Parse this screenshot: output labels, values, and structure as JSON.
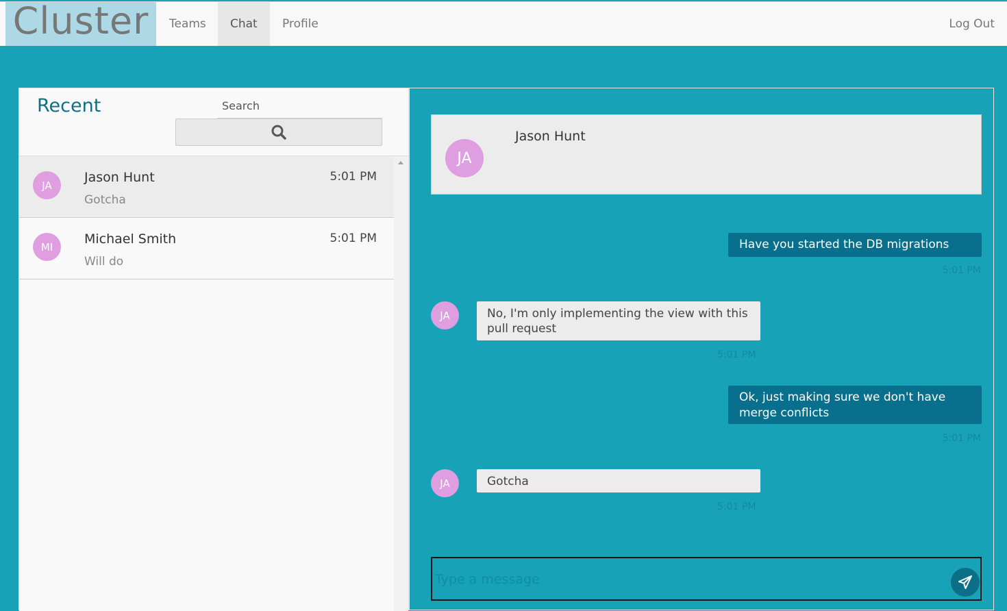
{
  "nav": {
    "brand": "Cluster",
    "items": [
      {
        "label": "Teams"
      },
      {
        "label": "Chat"
      },
      {
        "label": "Profile"
      }
    ],
    "logout": "Log Out"
  },
  "sidebar": {
    "title": "Recent",
    "search_label": "Search",
    "search_icon": "search-icon",
    "conversations": [
      {
        "initials": "JA",
        "name": "Jason Hunt",
        "time": "5:01 PM",
        "preview": "Gotcha"
      },
      {
        "initials": "MI",
        "name": "Michael Smith",
        "time": "5:01 PM",
        "preview": "Will do"
      }
    ]
  },
  "chat": {
    "contact": {
      "initials": "JA",
      "name": "Jason Hunt"
    },
    "messages": [
      {
        "direction": "out",
        "text": "Have you started the DB migrations",
        "time": "5:01 PM"
      },
      {
        "direction": "in",
        "initials": "JA",
        "text": "No, I'm only implementing the view with this pull request",
        "time": "5:01 PM"
      },
      {
        "direction": "out",
        "text": "Ok, just making sure we don't have merge conflicts",
        "time": "5:01 PM"
      },
      {
        "direction": "in",
        "initials": "JA",
        "text": "Gotcha",
        "time": "5:01 PM"
      }
    ],
    "compose_placeholder": "Type a message",
    "send_icon": "send-icon"
  },
  "colors": {
    "background": "#17a2b8",
    "outgoing_bubble": "#08708c",
    "incoming_bubble": "#ececec",
    "avatar": "#df9ee0",
    "brand_bg": "#add8e6"
  }
}
